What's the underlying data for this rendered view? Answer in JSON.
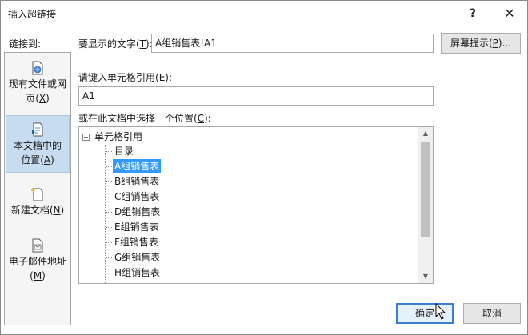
{
  "window": {
    "title": "插入超链接",
    "help_label": "?",
    "close_label": "✕"
  },
  "link_to": {
    "label": "链接到:",
    "items": [
      {
        "text": "现有文件或网页(",
        "key": "X",
        "suffix": ")",
        "icon": "web-page-icon",
        "selected": false
      },
      {
        "text": "本文档中的位置(",
        "key": "A",
        "suffix": ")",
        "icon": "document-place-icon",
        "selected": true
      },
      {
        "text": "新建文档(",
        "key": "N",
        "suffix": ")",
        "icon": "new-document-icon",
        "selected": false
      },
      {
        "text": "电子邮件地址(",
        "key": "M",
        "suffix": ")",
        "icon": "email-icon",
        "selected": false
      }
    ]
  },
  "display_text": {
    "label_prefix": "要显示的文字(",
    "label_key": "T",
    "label_suffix": "):",
    "value": "A组销售表!A1"
  },
  "screentip_button": {
    "prefix": "屏幕提示(",
    "key": "P",
    "suffix": ")..."
  },
  "cell_ref": {
    "label_prefix": "请键入单元格引用(",
    "label_key": "E",
    "label_suffix": "):",
    "value": "A1"
  },
  "place": {
    "label_prefix": "或在此文档中选择一个位置(",
    "label_key": "C",
    "label_suffix": "):",
    "root": "单元格引用",
    "items": [
      "目录",
      "A组销售表",
      "B组销售表",
      "C组销售表",
      "D组销售表",
      "E组销售表",
      "F组销售表",
      "G组销售表",
      "H组销售表"
    ],
    "selected_index": 1
  },
  "buttons": {
    "ok": "确定",
    "cancel": "取消"
  },
  "colors": {
    "selection": "#3399ff",
    "sidebar_selected": "#c7dcf0",
    "ok_border": "#3c7fd0"
  }
}
